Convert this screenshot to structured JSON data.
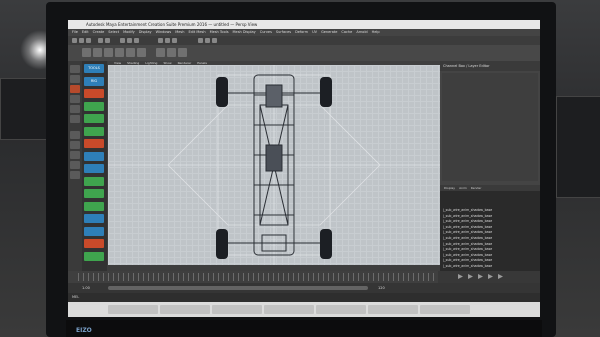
{
  "window": {
    "title": "Autodesk Maya Entertainment Creation Suite Premium 2016 — untitled — Persp View"
  },
  "menubar": {
    "items": [
      "File",
      "Edit",
      "Create",
      "Select",
      "Modify",
      "Display",
      "Windows",
      "Mesh",
      "Edit Mesh",
      "Mesh Tools",
      "Mesh Display",
      "Curves",
      "Surfaces",
      "Deform",
      "UV",
      "Generate",
      "Cache",
      "Arnold",
      "Help"
    ]
  },
  "viewport_menu": {
    "items": [
      "View",
      "Shading",
      "Lighting",
      "Show",
      "Renderer",
      "Panels"
    ]
  },
  "sidebar": {
    "buttons": [
      {
        "label": "TOOLS",
        "color": "#2e7fb8"
      },
      {
        "label": "RIG",
        "color": "#2e7fb8"
      },
      {
        "label": "",
        "color": "#c84a2a"
      },
      {
        "label": "",
        "color": "#3fa44e"
      },
      {
        "label": "",
        "color": "#3fa44e"
      },
      {
        "label": "",
        "color": "#3fa44e"
      },
      {
        "label": "",
        "color": "#c84a2a"
      },
      {
        "label": "",
        "color": "#2e7fb8"
      },
      {
        "label": "",
        "color": "#2e7fb8"
      },
      {
        "label": "",
        "color": "#3fa44e"
      },
      {
        "label": "",
        "color": "#3fa44e"
      },
      {
        "label": "",
        "color": "#3fa44e"
      },
      {
        "label": "",
        "color": "#2e7fb8"
      },
      {
        "label": "",
        "color": "#2e7fb8"
      },
      {
        "label": "",
        "color": "#c84a2a"
      },
      {
        "label": "",
        "color": "#3fa44e"
      }
    ]
  },
  "right_panel": {
    "header": "Channel Box / Layer Editor"
  },
  "outliner": {
    "tabs": [
      "Display",
      "Anim",
      "Render"
    ],
    "rows": [
      "|_sub_wire_anim_shadow_base",
      "|_sub_wire_anim_shadow_base",
      "|_sub_wire_anim_shadow_base",
      "|_sub_wire_anim_shadow_base",
      "|_sub_wire_anim_shadow_base",
      "|_sub_wire_anim_shadow_base",
      "|_sub_wire_anim_shadow_base",
      "|_sub_wire_anim_shadow_base",
      "|_sub_wire_anim_shadow_base",
      "|_sub_wire_anim_shadow_base",
      "|_sub_wire_anim_shadow_base"
    ]
  },
  "timeline": {
    "start": "1.00",
    "end": "120"
  },
  "cmdline": {
    "label": "MEL"
  },
  "taskbar": {
    "items": [
      "",
      "",
      "",
      "",
      "",
      "",
      ""
    ]
  },
  "colors": {
    "viewport_bg": "#bfc4c8",
    "wireframe": "#2a2e34",
    "ui_dark": "#3d3d3d"
  }
}
